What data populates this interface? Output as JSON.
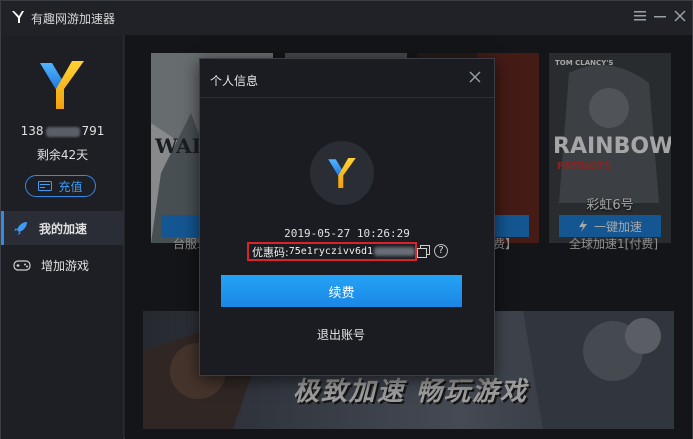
{
  "app": {
    "title": "有趣网游加速器",
    "accent": "#1f84e0"
  },
  "window_controls": {
    "menu_icon": "menu-icon",
    "minimize_icon": "minimize-icon",
    "close_icon": "close-icon"
  },
  "sidebar": {
    "phone_prefix": "138",
    "phone_suffix": "791",
    "remaining": "剩余42天",
    "recharge_label": "充值",
    "nav": [
      {
        "label": "我的加速",
        "icon": "rocket-icon",
        "active": true
      },
      {
        "label": "增加游戏",
        "icon": "gamepad-icon",
        "active": false
      }
    ]
  },
  "games": [
    {
      "name": "wa",
      "art_text": "WAR",
      "button": "一",
      "caption": "台服章"
    },
    {
      "name": "",
      "art_text": "",
      "button": "",
      "caption": ""
    },
    {
      "name": "",
      "art_text": "",
      "button": "",
      "caption": "费】"
    },
    {
      "name": "彩虹6号",
      "art_top": "TOM CLANCY'S",
      "art_text": "RAINBOW",
      "art_sub": "PATRIOTS",
      "button": "一键加速",
      "caption": "全球加速1[付费]"
    }
  ],
  "banner": {
    "text": "极致加速 畅玩游戏"
  },
  "dialog": {
    "title": "个人信息",
    "datetime": "2019-05-27 10:26:29",
    "promo_label": "优惠码:",
    "promo_code": "75e1ryczivv6d1",
    "renew_label": "续费",
    "logout_label": "退出账号",
    "help_glyph": "?"
  }
}
